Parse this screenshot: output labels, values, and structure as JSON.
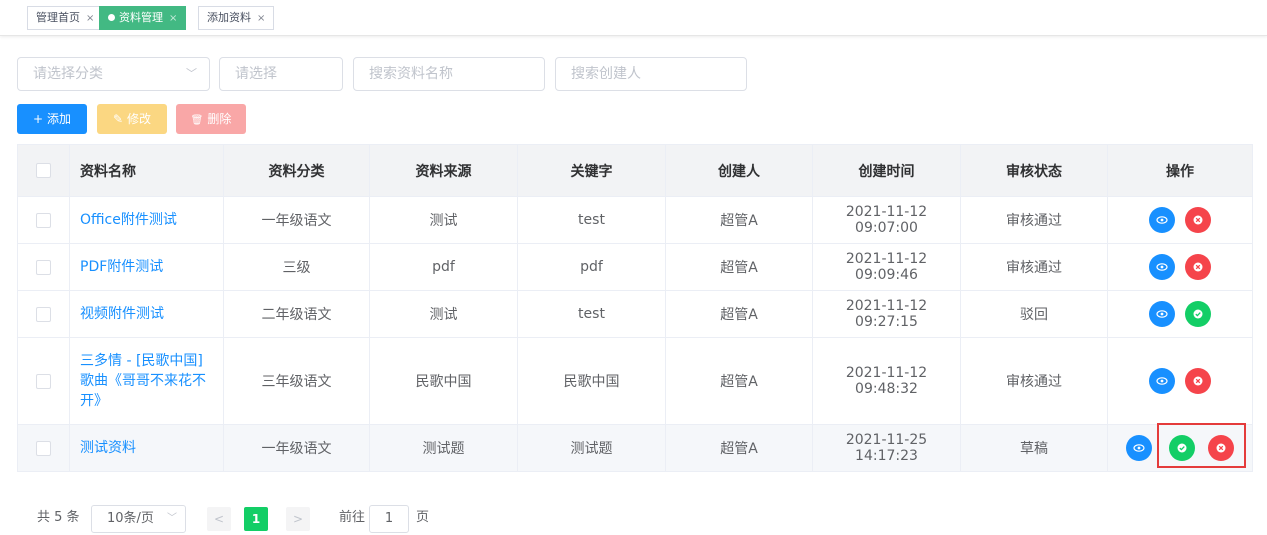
{
  "tabs": [
    {
      "label": "管理首页",
      "close": "×",
      "active": false
    },
    {
      "label": "资料管理",
      "close": "×",
      "active": true
    },
    {
      "label": "添加资料",
      "close": "×",
      "active": false
    }
  ],
  "filters": {
    "category_placeholder": "请选择分类",
    "select_placeholder": "请选择",
    "name_placeholder": "搜索资料名称",
    "creator_placeholder": "搜索创建人",
    "arrow": "﹀"
  },
  "toolbar": {
    "add_label": "添加",
    "add_icon": "+",
    "edit_label": "修改",
    "edit_icon": "✎",
    "delete_label": "删除",
    "delete_icon": "🗑"
  },
  "table": {
    "headers": [
      "资料名称",
      "资料分类",
      "资料来源",
      "关键字",
      "创建人",
      "创建时间",
      "审核状态",
      "操作"
    ],
    "rows": [
      {
        "name": "Office附件测试",
        "category": "一年级语文",
        "source": "测试",
        "keyword": "test",
        "creator": "超管A",
        "created": "2021-11-12 09:07:00",
        "status": "审核通过"
      },
      {
        "name": "PDF附件测试",
        "category": "三级",
        "source": "pdf",
        "keyword": "pdf",
        "creator": "超管A",
        "created": "2021-11-12 09:09:46",
        "status": "审核通过"
      },
      {
        "name": "视频附件测试",
        "category": "二年级语文",
        "source": "测试",
        "keyword": "test",
        "creator": "超管A",
        "created": "2021-11-12 09:27:15",
        "status": "驳回"
      },
      {
        "name": "三多情 - [民歌中国]歌曲《哥哥不来花不开》",
        "category": "三年级语文",
        "source": "民歌中国",
        "keyword": "民歌中国",
        "creator": "超管A",
        "created": "2021-11-12 09:48:32",
        "status": "审核通过"
      },
      {
        "name": "测试资料",
        "category": "一年级语文",
        "source": "测试题",
        "keyword": "测试题",
        "creator": "超管A",
        "created": "2021-11-25 14:17:23",
        "status": "草稿"
      }
    ]
  },
  "pagination": {
    "total": "共 5 条",
    "page_size": "10条/页",
    "prev": "<",
    "current": "1",
    "next": ">",
    "goto_prefix": "前往",
    "goto_value": "1",
    "goto_suffix": "页"
  },
  "colors": {
    "primary": "#1890ff",
    "success": "#13ce66",
    "danger": "#f5444b",
    "tab_active": "#42b983",
    "highlight": "#e43b3b"
  }
}
